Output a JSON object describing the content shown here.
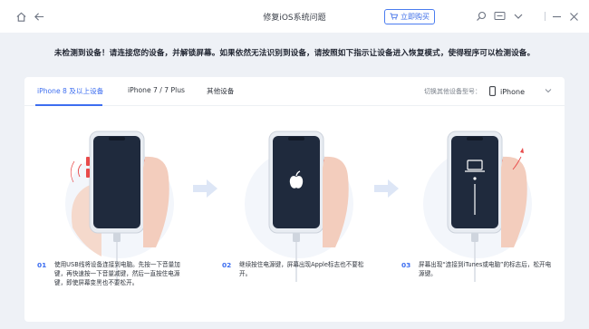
{
  "window": {
    "title": "修复iOS系统问题",
    "buy_label": "立即购买",
    "icons": [
      "home-icon",
      "back-icon",
      "cart-icon",
      "search-icon",
      "feedback-icon",
      "dropdown-icon",
      "minimize-icon",
      "close-icon"
    ]
  },
  "warning": "未检测到设备！请连接您的设备，并解锁屏幕。如果依然无法识别到设备，请按照如下指示让设备进入恢复模式，使得程序可以检测设备。",
  "tabs": [
    {
      "label": "iPhone 8 及以上设备",
      "active": true
    },
    {
      "label": "iPhone 7 / 7 Plus",
      "active": false
    },
    {
      "label": "其他设备",
      "active": false
    }
  ],
  "device_switch": {
    "label": "切换其他设备型号：",
    "selected": "iPhone"
  },
  "steps": [
    {
      "num": "01",
      "text": "使用USB线将设备连接到电脑。先按一下音量加键，再快速按一下音量减键，然后一直按住电源键，即使屏幕变黑也不要松开。"
    },
    {
      "num": "02",
      "text": "继续按住电源键，屏幕出现Apple标志也不要松开。"
    },
    {
      "num": "03",
      "text": "屏幕出现“连接到iTunes或电脑”的标志后，松开电源键。"
    }
  ],
  "colors": {
    "accent": "#3d6ef0",
    "button_indicator": "#e84a4a",
    "phone_screen": "#1f2a3d"
  }
}
